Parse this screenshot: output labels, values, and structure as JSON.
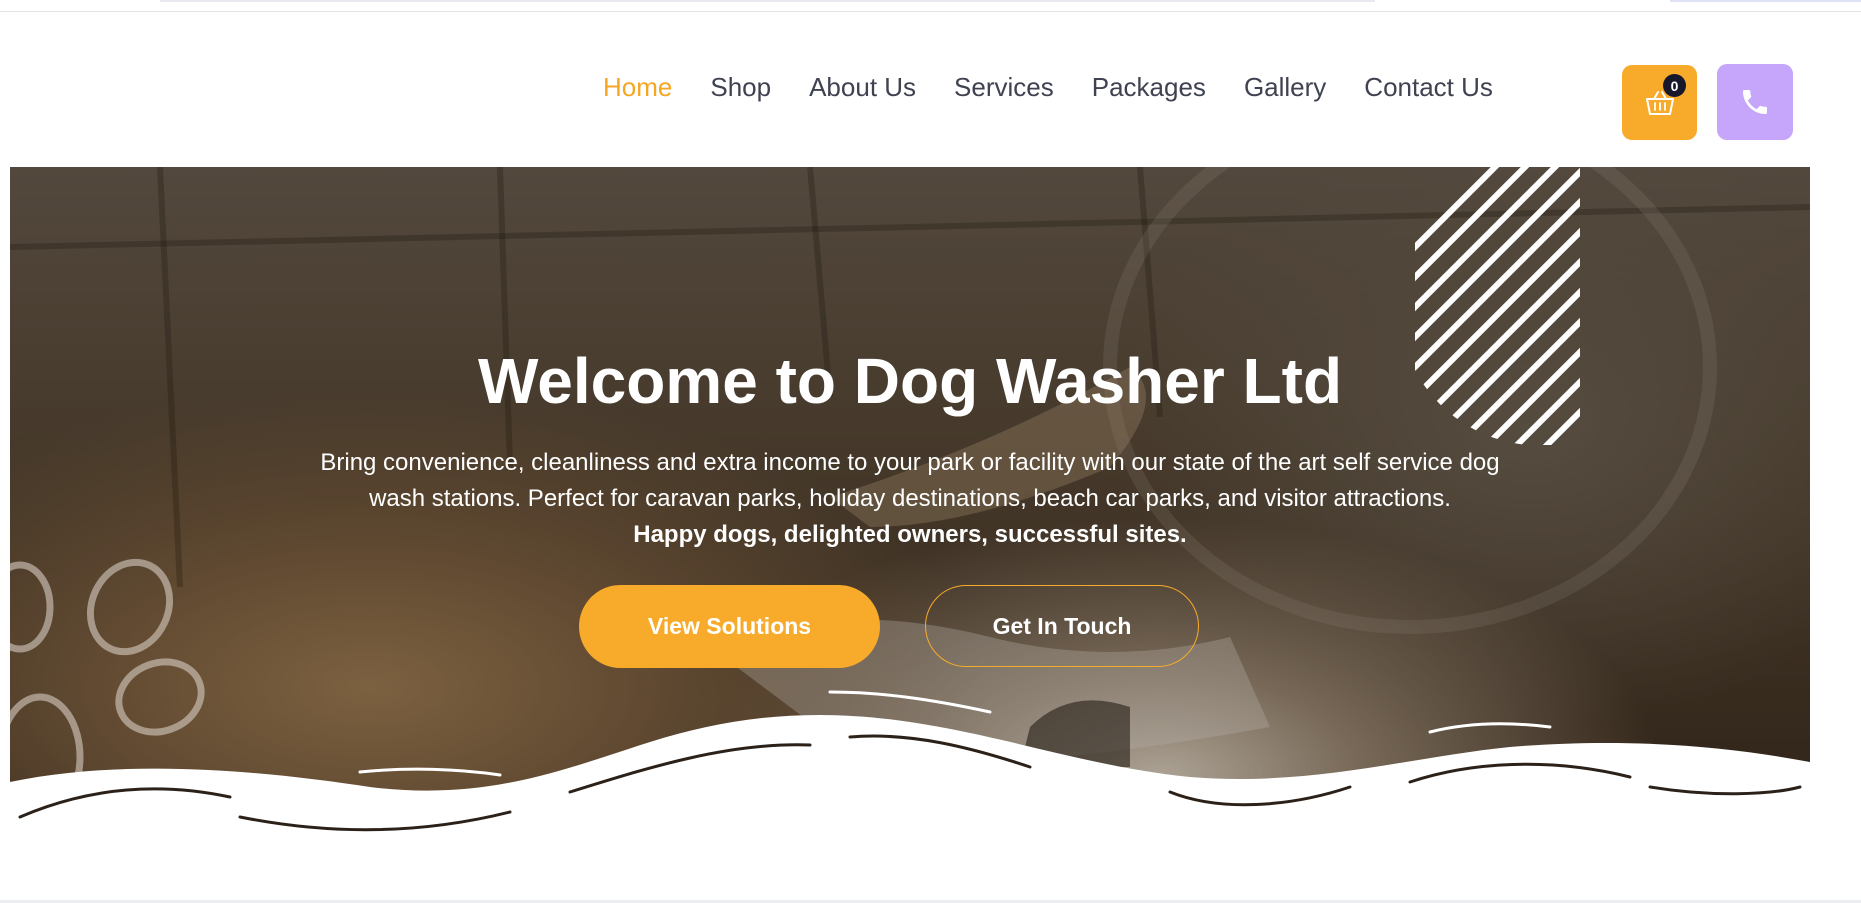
{
  "nav": {
    "items": [
      {
        "label": "Home",
        "active": true
      },
      {
        "label": "Shop",
        "active": false
      },
      {
        "label": "About Us",
        "active": false
      },
      {
        "label": "Services",
        "active": false
      },
      {
        "label": "Packages",
        "active": false
      },
      {
        "label": "Gallery",
        "active": false
      },
      {
        "label": "Contact Us",
        "active": false
      }
    ]
  },
  "cart": {
    "count": "0",
    "icon": "basket-icon",
    "color": "#f8ab2a"
  },
  "phone": {
    "icon": "phone-icon",
    "color": "#c5a6fb"
  },
  "hero": {
    "title": "Welcome to Dog Washer Ltd",
    "description": "Bring convenience, cleanliness and extra income to your park or facility with our state of the art self service dog wash stations. Perfect for caravan parks, holiday destinations, beach car parks, and visitor attractions.",
    "tagline": "Happy dogs, delighted owners, successful sites.",
    "primary_button": "View Solutions",
    "secondary_button": "Get In Touch"
  },
  "colors": {
    "accent": "#f5a623",
    "nav_text": "#3f4250",
    "cart_badge": "#17162b"
  }
}
